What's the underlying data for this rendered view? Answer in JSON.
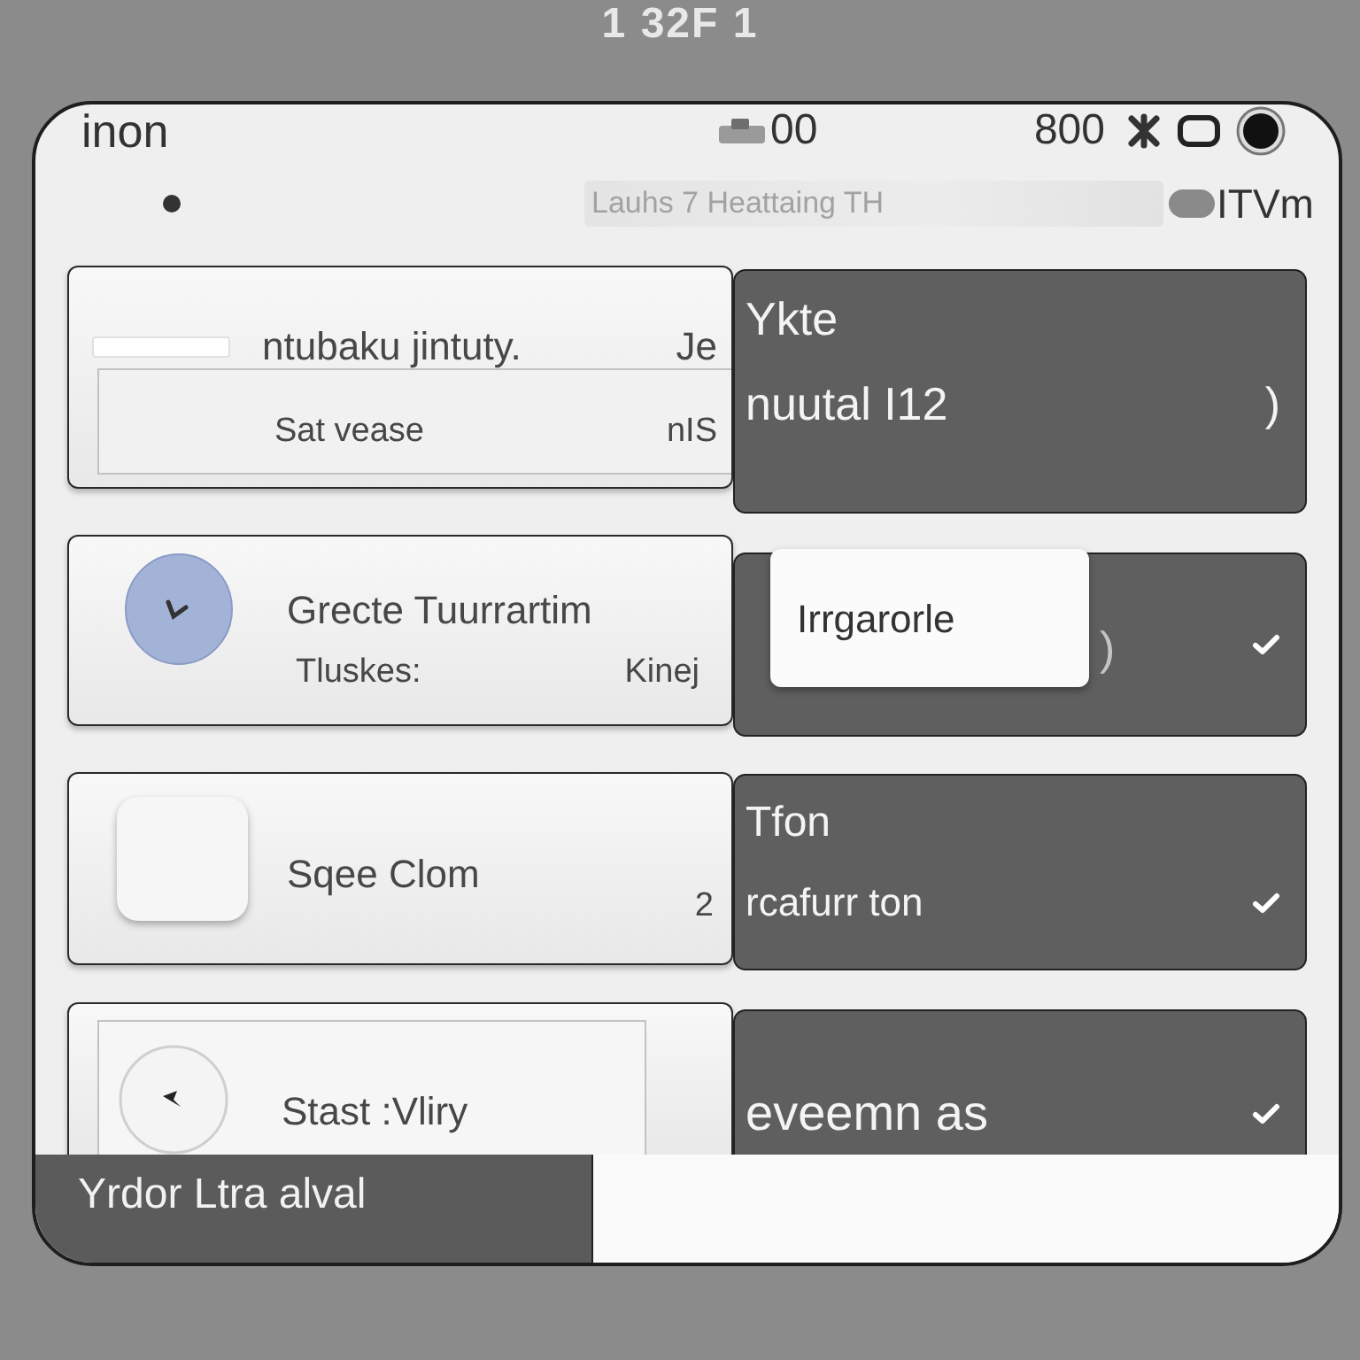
{
  "caption": "1 32F 1",
  "status_bar": {
    "title": "inon",
    "center_text": "00",
    "right_text": "800"
  },
  "search": {
    "placeholder": "Lauhs 7 Heattaing TH"
  },
  "account_label": "ITVm",
  "rows": [
    {
      "kind": "field",
      "title": "ntubaku jintuty.",
      "title_suffix": "Je",
      "subtitle": "Sat vease",
      "detail": "nIS",
      "panel": {
        "title": "Ykte",
        "subtitle": "nuutal I12",
        "trail": ")",
        "checked": false
      }
    },
    {
      "kind": "check",
      "title": "Grecte Tuurrartim",
      "subtitle": "Tluskes:",
      "detail": "Kinej",
      "panel": {
        "popup": "Irrgarorle",
        "trail": ")",
        "checked": true
      }
    },
    {
      "kind": "tile",
      "title": "Sqee Clom",
      "detail": "2",
      "panel": {
        "title": "Tfon",
        "subtitle": "rcafurr ton",
        "checked": true
      }
    },
    {
      "kind": "circle",
      "title": "Stast :Vliry",
      "panel": {
        "title": "eveemn as",
        "checked": true
      }
    }
  ],
  "bottom_bar": {
    "label": "Yrdor Ltra alval"
  }
}
